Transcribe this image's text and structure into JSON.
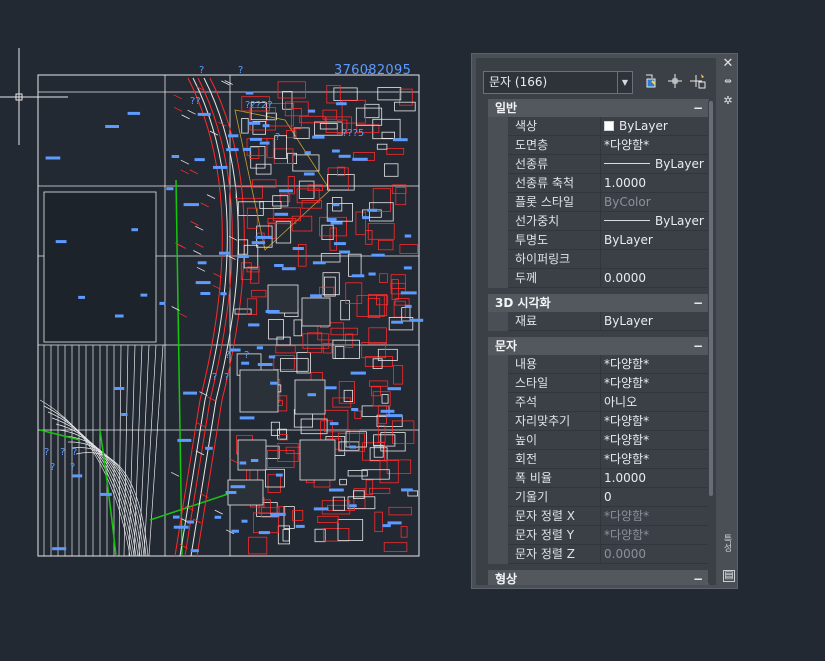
{
  "drawing": {
    "number_label": "376082095",
    "unknown_labels": [
      "?",
      "?",
      "?",
      "?",
      "???2?",
      "??",
      "???5",
      "?",
      "?",
      "?",
      "?",
      "?",
      "?",
      "?",
      "?",
      "?"
    ]
  },
  "palette": {
    "selector_value": "문자 (166)",
    "side_label": "특성",
    "sections": [
      {
        "title": "일반",
        "toggle": "−",
        "rows": [
          {
            "label": "색상",
            "value": "ByLayer",
            "swatch": true
          },
          {
            "label": "도면층",
            "value": "*다양함*"
          },
          {
            "label": "선종류",
            "value": "ByLayer",
            "line": true
          },
          {
            "label": "선종류 축척",
            "value": "1.0000"
          },
          {
            "label": "플롯 스타일",
            "value": "ByColor",
            "disabled": true
          },
          {
            "label": "선가중치",
            "value": "ByLayer",
            "line": true
          },
          {
            "label": "투명도",
            "value": "ByLayer"
          },
          {
            "label": "하이퍼링크",
            "value": ""
          },
          {
            "label": "두께",
            "value": "0.0000"
          }
        ]
      },
      {
        "title": "3D 시각화",
        "toggle": "−",
        "rows": [
          {
            "label": "재료",
            "value": "ByLayer"
          }
        ]
      },
      {
        "title": "문자",
        "toggle": "−",
        "rows": [
          {
            "label": "내용",
            "value": "*다양함*"
          },
          {
            "label": "스타일",
            "value": "*다양함*"
          },
          {
            "label": "주석",
            "value": "아니오"
          },
          {
            "label": "자리맞추기",
            "value": "*다양함*"
          },
          {
            "label": "높이",
            "value": "*다양함*"
          },
          {
            "label": "회전",
            "value": "*다양함*"
          },
          {
            "label": "폭 비율",
            "value": "1.0000"
          },
          {
            "label": "기울기",
            "value": "0"
          },
          {
            "label": "문자 정렬 X",
            "value": "*다양함*",
            "disabled": true
          },
          {
            "label": "문자 정렬 Y",
            "value": "*다양함*",
            "disabled": true
          },
          {
            "label": "문자 정렬 Z",
            "value": "0.0000",
            "disabled": true
          }
        ]
      },
      {
        "title": "형상",
        "toggle": "−",
        "rows": []
      }
    ]
  },
  "colors": {
    "background": "#222933",
    "cad_blue": "#5d9bff",
    "cad_red": "#ff2a2a",
    "cad_green": "#16c60c",
    "cad_white": "#e8e8e8"
  }
}
